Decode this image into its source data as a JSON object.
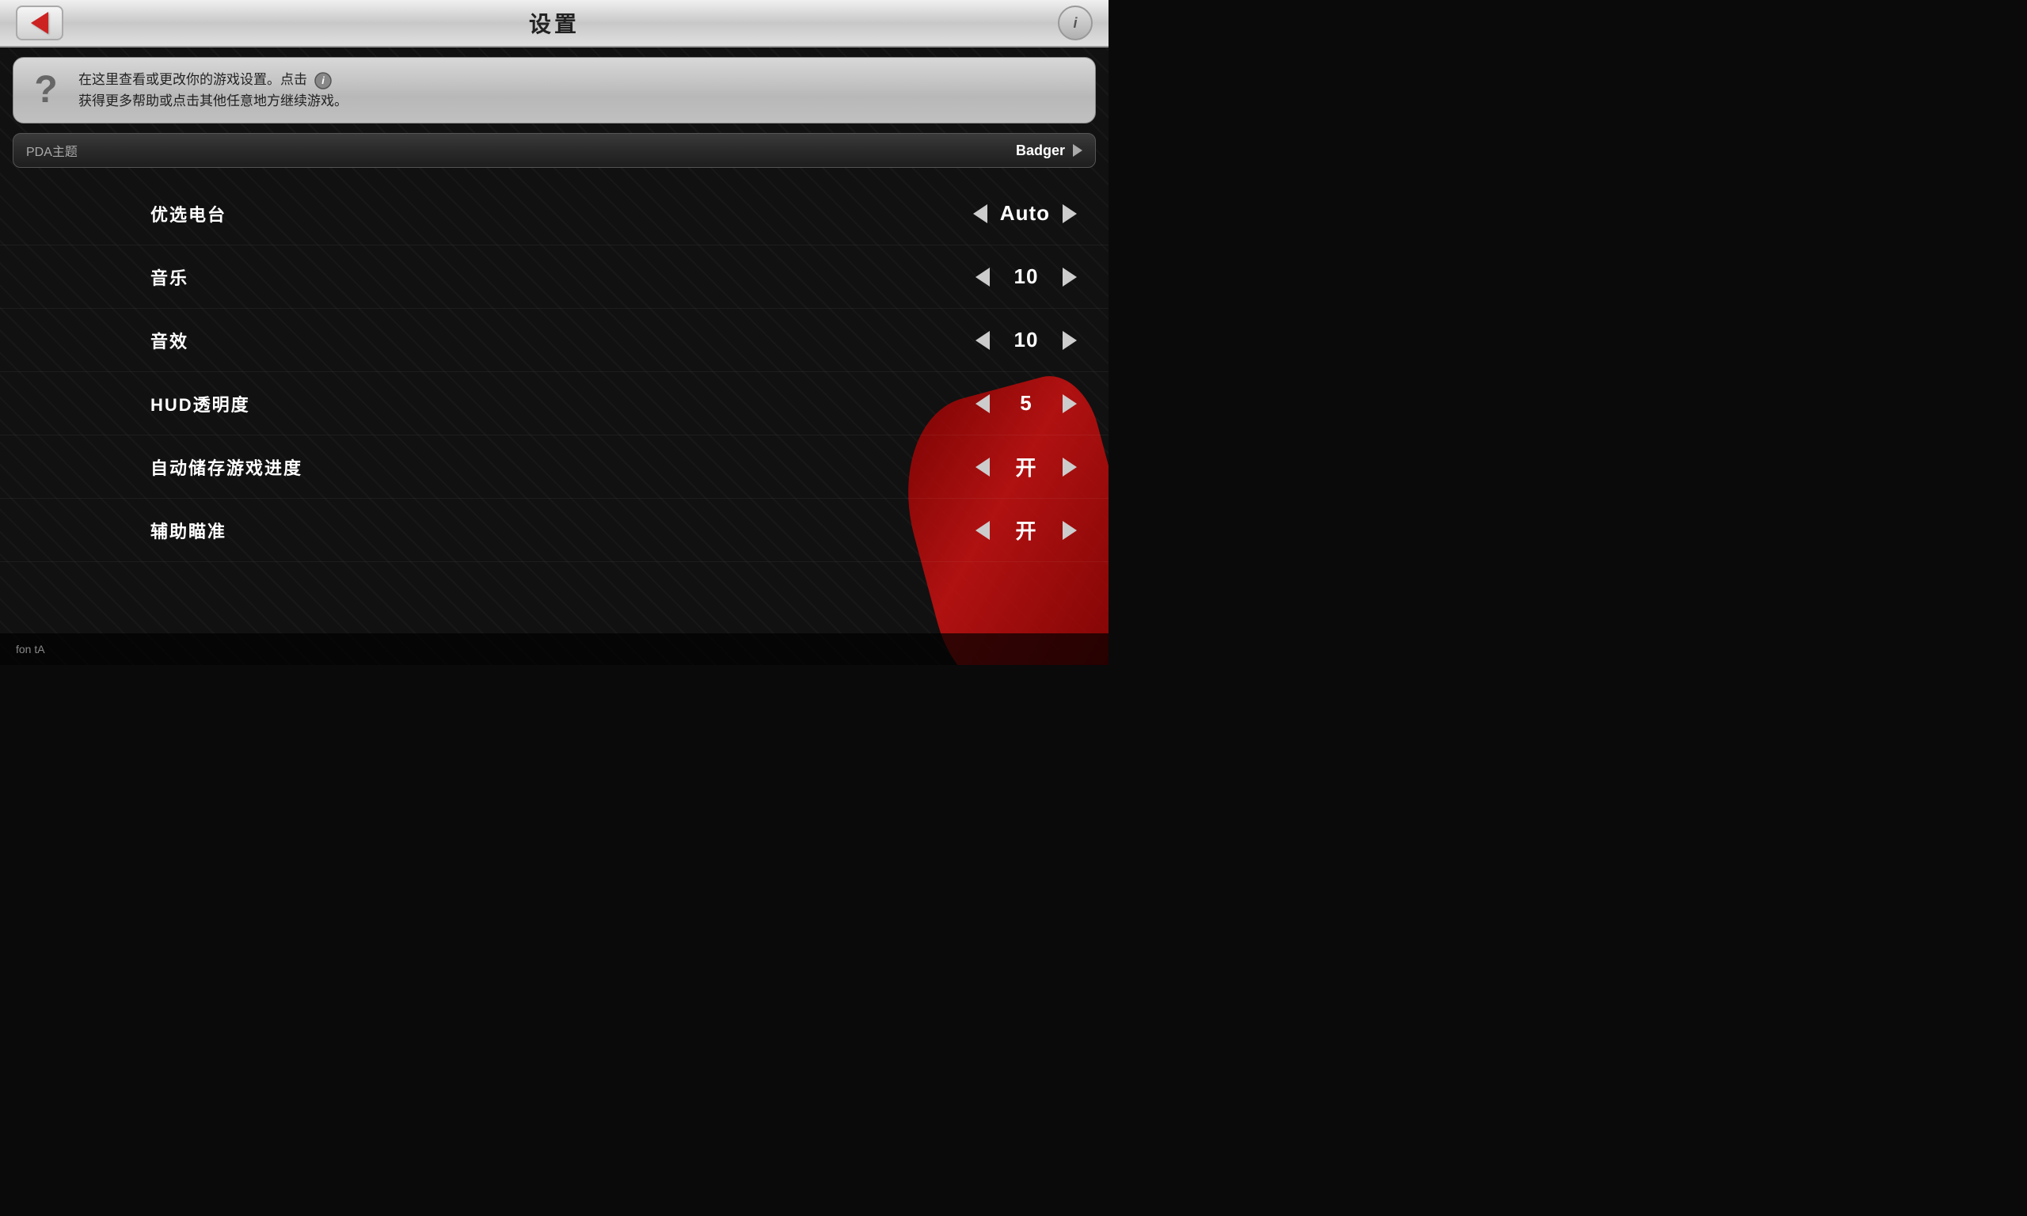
{
  "header": {
    "title": "设置",
    "back_label": "←",
    "info_label": "i"
  },
  "help": {
    "question_mark": "?",
    "text_line1": "在这里查看或更改你的游戏设置。点击",
    "text_line2": "获得更多帮助或点击其他任意地方继续游戏。"
  },
  "theme_row": {
    "label": "PDA主题",
    "value": "Badger"
  },
  "settings": [
    {
      "id": "preferred-radio",
      "label": "优选电台",
      "value": "Auto",
      "has_left_arrow": true,
      "has_right_arrow": true
    },
    {
      "id": "music",
      "label": "音乐",
      "value": "10",
      "has_left_arrow": true,
      "has_right_arrow": true
    },
    {
      "id": "sound-effects",
      "label": "音效",
      "value": "10",
      "has_left_arrow": true,
      "has_right_arrow": true
    },
    {
      "id": "hud-transparency",
      "label": "HUD透明度",
      "value": "5",
      "has_left_arrow": true,
      "has_right_arrow": true
    },
    {
      "id": "auto-save",
      "label": "自动储存游戏进度",
      "value": "开",
      "has_left_arrow": true,
      "has_right_arrow": true
    },
    {
      "id": "auto-aim",
      "label": "辅助瞄准",
      "value": "开",
      "has_left_arrow": true,
      "has_right_arrow": true
    }
  ],
  "bottom": {
    "text": "fon tA"
  }
}
